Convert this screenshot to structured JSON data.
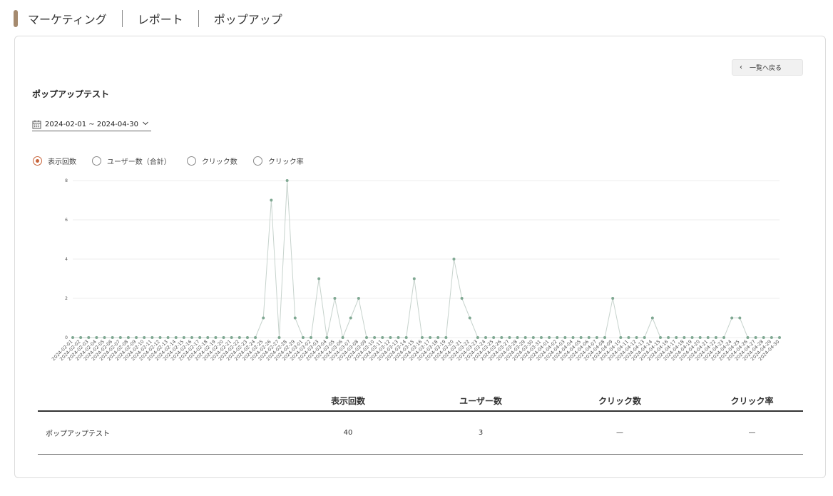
{
  "breadcrumb": {
    "items": [
      "マーケティング",
      "レポート",
      "ポップアップ"
    ]
  },
  "header": {
    "back_label": "一覧へ戻る",
    "back_chevron": "‹"
  },
  "page": {
    "title": "ポップアップテスト"
  },
  "date_range": {
    "value": "2024-02-01 ~ 2024-04-30"
  },
  "metric_radios": {
    "selected": "表示回数",
    "options": [
      "表示回数",
      "ユーザー数（合計）",
      "クリック数",
      "クリック率"
    ]
  },
  "chart_data": {
    "type": "line",
    "x": [
      "2024-02-01",
      "2024-02-02",
      "2024-02-03",
      "2024-02-04",
      "2024-02-05",
      "2024-02-06",
      "2024-02-07",
      "2024-02-08",
      "2024-02-09",
      "2024-02-10",
      "2024-02-11",
      "2024-02-12",
      "2024-02-13",
      "2024-02-14",
      "2024-02-15",
      "2024-02-16",
      "2024-02-17",
      "2024-02-18",
      "2024-02-19",
      "2024-02-20",
      "2024-02-21",
      "2024-02-22",
      "2024-02-23",
      "2024-02-24",
      "2024-02-25",
      "2024-02-26",
      "2024-02-27",
      "2024-02-28",
      "2024-02-29",
      "2024-03-01",
      "2024-03-02",
      "2024-03-03",
      "2024-03-04",
      "2024-03-05",
      "2024-03-06",
      "2024-03-07",
      "2024-03-08",
      "2024-03-09",
      "2024-03-10",
      "2024-03-11",
      "2024-03-12",
      "2024-03-13",
      "2024-03-14",
      "2024-03-15",
      "2024-03-16",
      "2024-03-17",
      "2024-03-18",
      "2024-03-19",
      "2024-03-20",
      "2024-03-21",
      "2024-03-22",
      "2024-03-23",
      "2024-03-24",
      "2024-03-25",
      "2024-03-26",
      "2024-03-27",
      "2024-03-28",
      "2024-03-29",
      "2024-03-30",
      "2024-03-31",
      "2024-04-01",
      "2024-04-02",
      "2024-04-03",
      "2024-04-04",
      "2024-04-05",
      "2024-04-06",
      "2024-04-07",
      "2024-04-08",
      "2024-04-09",
      "2024-04-10",
      "2024-04-11",
      "2024-04-12",
      "2024-04-13",
      "2024-04-14",
      "2024-04-15",
      "2024-04-16",
      "2024-04-17",
      "2024-04-18",
      "2024-04-19",
      "2024-04-20",
      "2024-04-21",
      "2024-04-22",
      "2024-04-23",
      "2024-04-24",
      "2024-04-25",
      "2024-04-26",
      "2024-04-27",
      "2024-04-28",
      "2024-04-29",
      "2024-04-30"
    ],
    "series": [
      {
        "values": [
          0,
          0,
          0,
          0,
          0,
          0,
          0,
          0,
          0,
          0,
          0,
          0,
          0,
          0,
          0,
          0,
          0,
          0,
          0,
          0,
          0,
          0,
          0,
          0,
          1,
          7,
          0,
          8,
          1,
          0,
          0,
          3,
          0,
          2,
          0,
          1,
          2,
          0,
          0,
          0,
          0,
          0,
          0,
          3,
          0,
          0,
          0,
          0,
          4,
          2,
          1,
          0,
          0,
          0,
          0,
          0,
          0,
          0,
          0,
          0,
          0,
          0,
          0,
          0,
          0,
          0,
          0,
          0,
          2,
          0,
          0,
          0,
          0,
          1,
          0,
          0,
          0,
          0,
          0,
          0,
          0,
          0,
          0,
          1,
          1,
          0,
          0,
          0,
          0,
          0
        ]
      }
    ],
    "y_ticks": [
      0,
      2,
      4,
      6,
      8
    ],
    "ylim": [
      0,
      8
    ],
    "grid": true,
    "legend": "none",
    "colors": {
      "line": "#c7d3cd",
      "point": "#7fa892",
      "grid": "#ececec",
      "tick_text": "#555555"
    }
  },
  "table": {
    "headers": [
      "",
      "表示回数",
      "ユーザー数",
      "クリック数",
      "クリック率"
    ],
    "rows": [
      {
        "name": "ポップアップテスト",
        "views": "40",
        "users": "3",
        "clicks": "—",
        "rate": "—"
      }
    ]
  },
  "colors": {
    "accent": "#c8643a",
    "breadcrumb_bar": "#a58a6e"
  }
}
